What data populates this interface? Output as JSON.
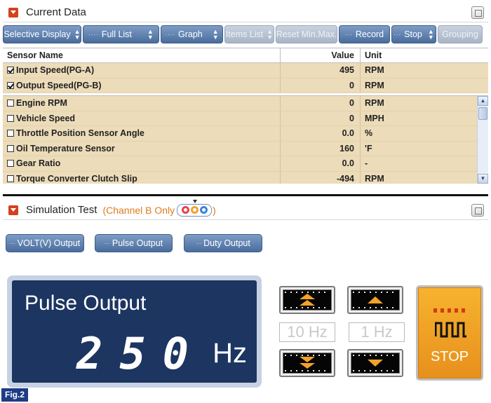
{
  "current_data": {
    "title": "Current Data",
    "toolbar": [
      {
        "label": "Selective Display",
        "arrows": true,
        "dots": false,
        "enabled": true
      },
      {
        "label": "Full List",
        "arrows": true,
        "dots": true,
        "enabled": true
      },
      {
        "label": "Graph",
        "arrows": true,
        "dots": true,
        "enabled": true
      },
      {
        "label": "Items List",
        "arrows": true,
        "dots": false,
        "enabled": false
      },
      {
        "label": "Reset Min.Max.",
        "arrows": false,
        "dots": false,
        "enabled": false
      },
      {
        "label": "Record",
        "arrows": false,
        "dots": true,
        "enabled": true
      },
      {
        "label": "Stop",
        "arrows": true,
        "dots": true,
        "enabled": true
      },
      {
        "label": "Grouping",
        "arrows": false,
        "dots": false,
        "enabled": false
      }
    ],
    "columns": {
      "name": "Sensor Name",
      "value": "Value",
      "unit": "Unit"
    },
    "pinned_rows": [
      {
        "checked": true,
        "name": "Input Speed(PG-A)",
        "value": "495",
        "unit": "RPM"
      },
      {
        "checked": true,
        "name": "Output Speed(PG-B)",
        "value": "0",
        "unit": "RPM"
      }
    ],
    "rows": [
      {
        "checked": false,
        "name": "Engine RPM",
        "value": "0",
        "unit": "RPM"
      },
      {
        "checked": false,
        "name": "Vehicle Speed",
        "value": "0",
        "unit": "MPH"
      },
      {
        "checked": false,
        "name": "Throttle Position Sensor Angle",
        "value": "0.0",
        "unit": "%"
      },
      {
        "checked": false,
        "name": "Oil Temperature Sensor",
        "value": "160",
        "unit": "'F"
      },
      {
        "checked": false,
        "name": "Gear Ratio",
        "value": "0.0",
        "unit": "-"
      },
      {
        "checked": false,
        "name": "Torque Converter Clutch Slip",
        "value": "-494",
        "unit": "RPM"
      }
    ]
  },
  "simulation": {
    "title": "Simulation Test",
    "subtitle": "(Channel B Only",
    "subtitle_end": ")",
    "channel_colors": [
      "#e8434a",
      "#f2a22a",
      "#3a86d4"
    ],
    "output_buttons": [
      "VOLT(V) Output",
      "Pulse Output",
      "Duty Output"
    ],
    "display": {
      "title": "Pulse Output",
      "value": "250",
      "unit": "Hz"
    },
    "steps": {
      "coarse": "10 Hz",
      "fine": "1 Hz"
    },
    "stop_label": "STOP"
  },
  "figure_label": "Fig.2",
  "colors": {
    "accent": "#4a6d9d",
    "row_bg": "#ecdcb9",
    "display_bg": "#1c3561",
    "stop_bg": "#f2a22a"
  }
}
